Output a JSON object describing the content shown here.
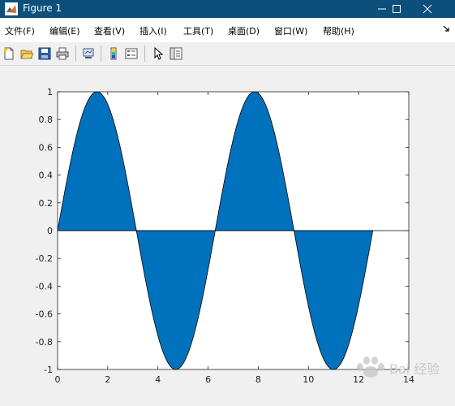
{
  "window": {
    "title": "Figure 1",
    "titlebar_color": "#0b4f7a"
  },
  "menubar": {
    "items": [
      {
        "label": "文件(F)"
      },
      {
        "label": "编辑(E)"
      },
      {
        "label": "查看(V)"
      },
      {
        "label": "插入(I)"
      },
      {
        "label": "工具(T)"
      },
      {
        "label": "桌面(D)"
      },
      {
        "label": "窗口(W)"
      },
      {
        "label": "帮助(H)"
      }
    ],
    "overflow_icon": "arrow-down-right-icon"
  },
  "toolbar": {
    "buttons": [
      {
        "icon": "new-figure-icon"
      },
      {
        "icon": "open-file-icon"
      },
      {
        "icon": "save-icon"
      },
      {
        "icon": "print-icon"
      },
      {
        "icon": "link-plot-icon"
      },
      {
        "icon": "insert-colorbar-icon"
      },
      {
        "icon": "insert-legend-icon"
      },
      {
        "icon": "edit-plot-pointer-icon"
      },
      {
        "icon": "property-inspector-icon"
      }
    ]
  },
  "chart_data": {
    "type": "area",
    "title": "",
    "xlabel": "",
    "ylabel": "",
    "xlim": [
      0,
      14
    ],
    "ylim": [
      -1,
      1
    ],
    "xticks": [
      "0",
      "2",
      "4",
      "6",
      "8",
      "10",
      "12",
      "14"
    ],
    "yticks": [
      "1",
      "0.8",
      "0.6",
      "0.4",
      "0.2",
      "0",
      "-0.2",
      "-0.4",
      "-0.6",
      "-0.8",
      "-1"
    ],
    "x": [
      0,
      0.5,
      1.0,
      1.5708,
      2.0,
      2.5,
      3.1416,
      3.5,
      4.0,
      4.7124,
      5.5,
      6.2832,
      7.0,
      7.854,
      8.5,
      9.4248,
      10.2,
      10.9956,
      11.8,
      12.5664
    ],
    "series": [
      {
        "function": "sin(x)",
        "x_start": 0,
        "x_end": 12.5664,
        "fill_baseline": 0,
        "fill_color": "#0072bd",
        "edge_color": "#000000"
      }
    ],
    "grid": false,
    "legend": false
  },
  "watermark": {
    "text": "Bai 经验"
  }
}
